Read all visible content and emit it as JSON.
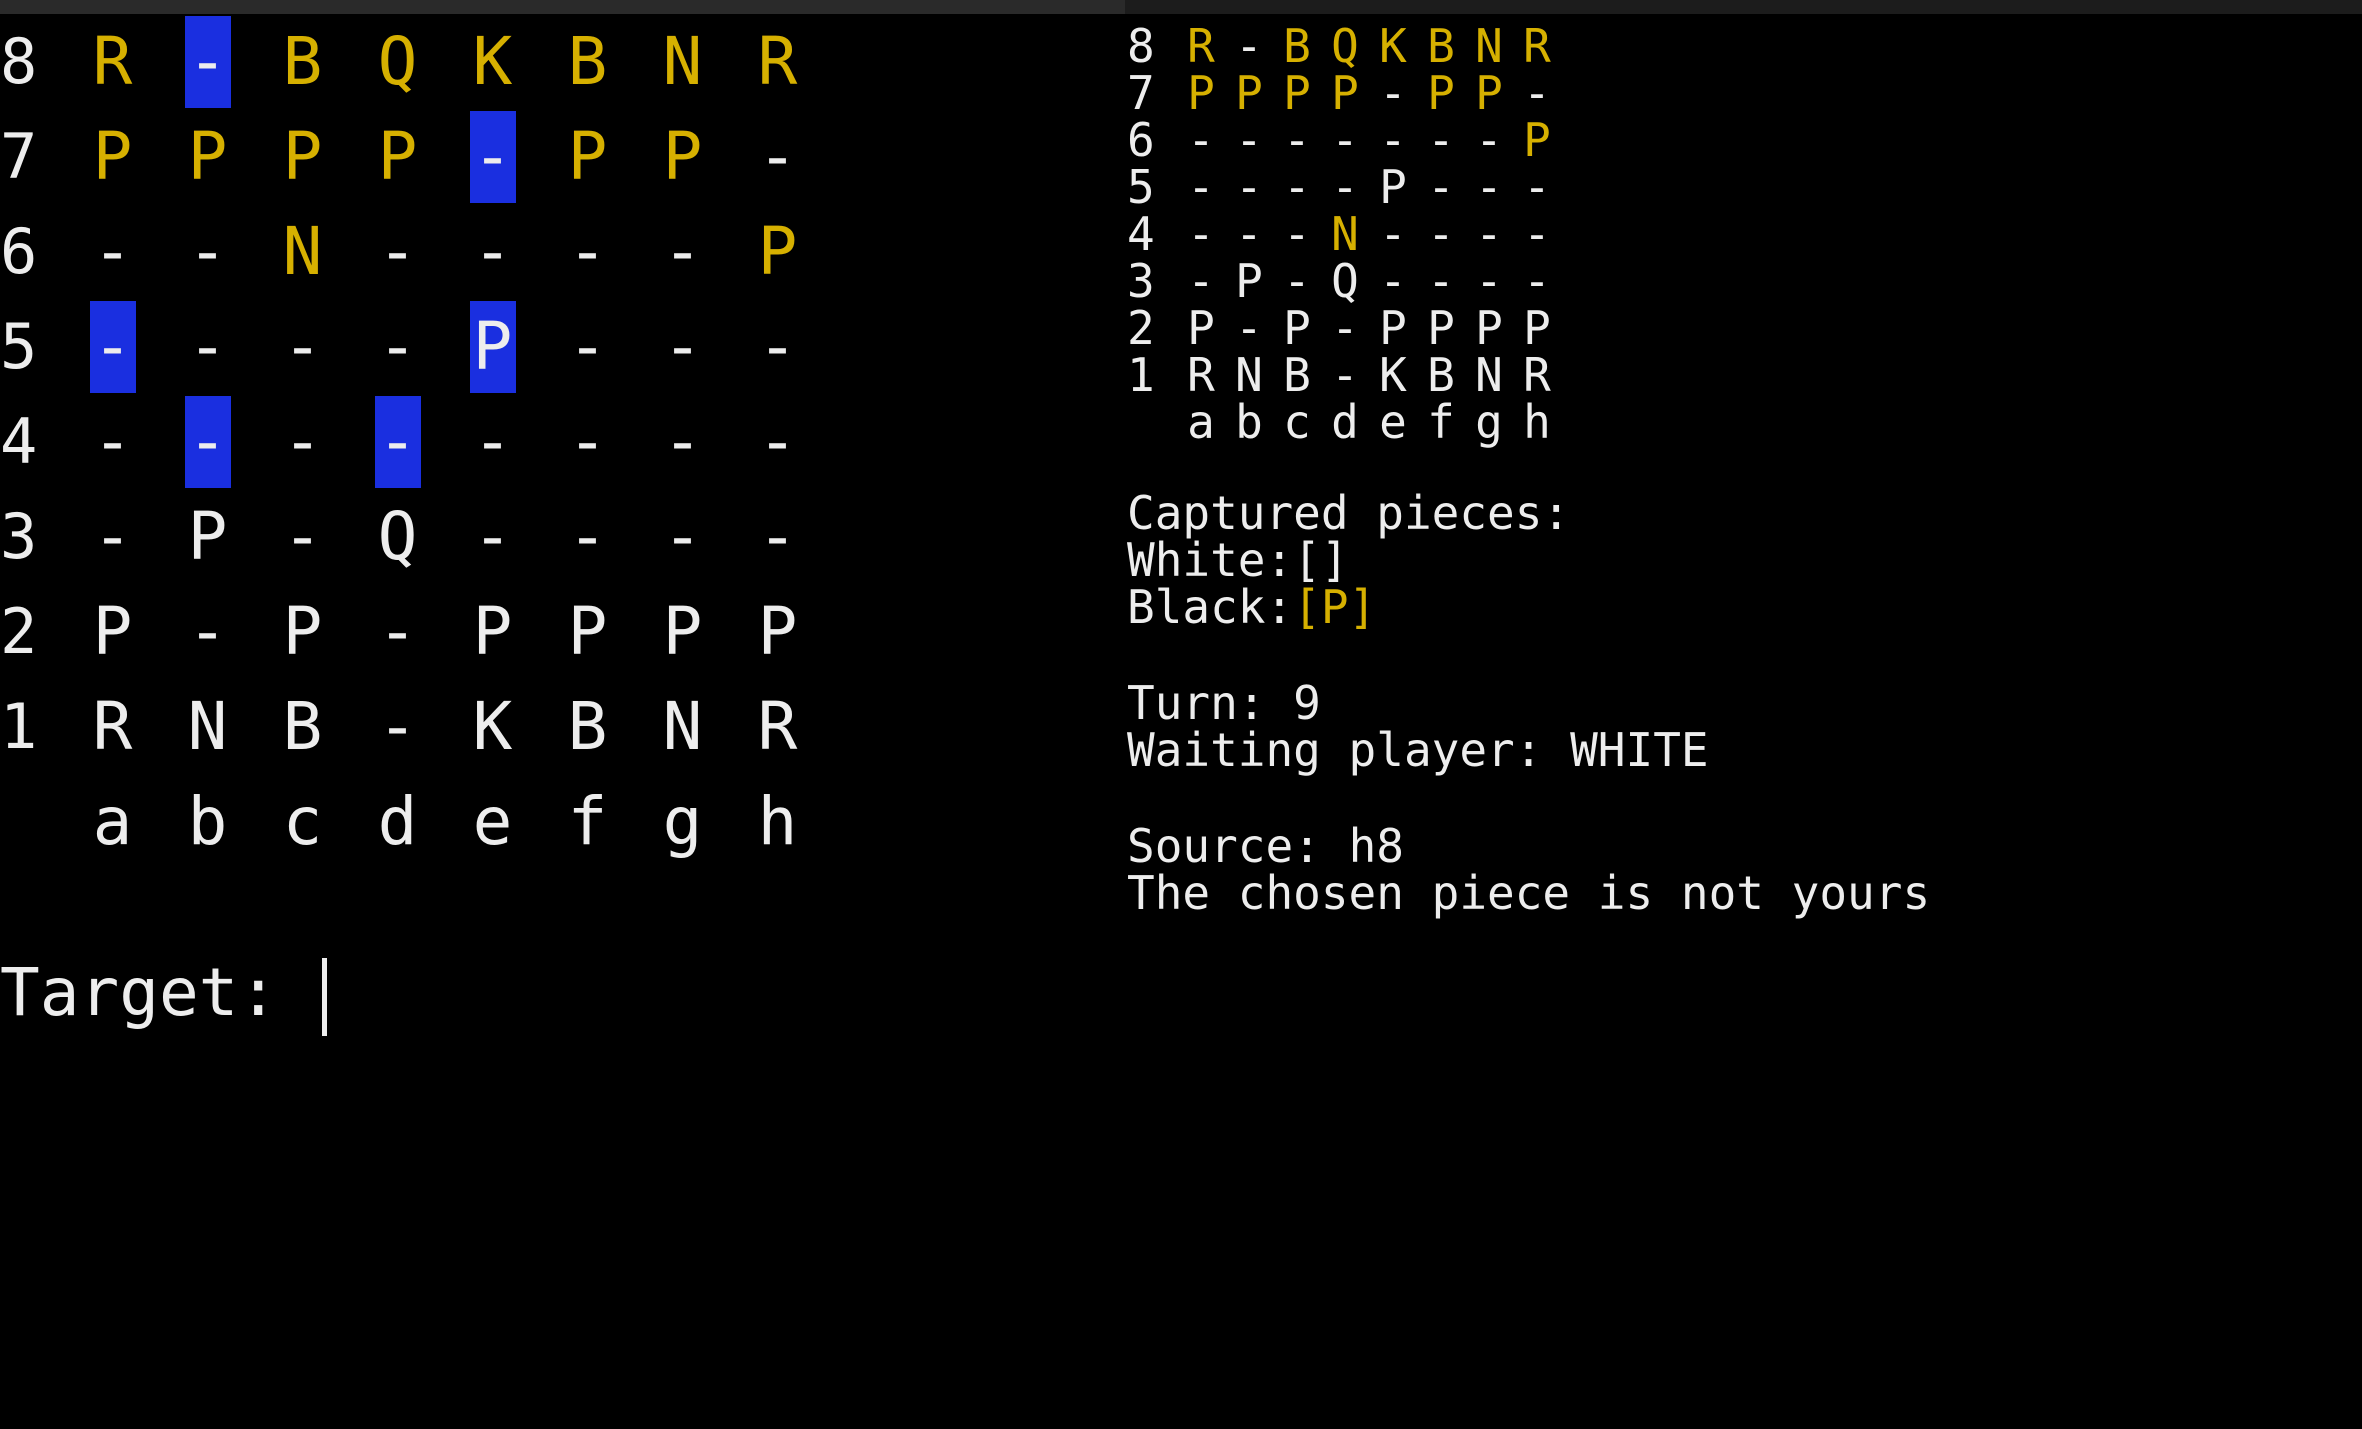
{
  "colors": {
    "background": "#000000",
    "white_text": "#ededed",
    "black_piece": "#d6b000",
    "highlight": "#1a2fe0"
  },
  "left_board": {
    "files": [
      "a",
      "b",
      "c",
      "d",
      "e",
      "f",
      "g",
      "h"
    ],
    "rows": [
      {
        "rank": "8",
        "cells": [
          {
            "c": "R",
            "side": "black"
          },
          {
            "c": "-",
            "side": "empty",
            "hl": true
          },
          {
            "c": "B",
            "side": "black"
          },
          {
            "c": "Q",
            "side": "black"
          },
          {
            "c": "K",
            "side": "black"
          },
          {
            "c": "B",
            "side": "black"
          },
          {
            "c": "N",
            "side": "black"
          },
          {
            "c": "R",
            "side": "black"
          }
        ]
      },
      {
        "rank": "7",
        "cells": [
          {
            "c": "P",
            "side": "black"
          },
          {
            "c": "P",
            "side": "black"
          },
          {
            "c": "P",
            "side": "black"
          },
          {
            "c": "P",
            "side": "black"
          },
          {
            "c": "-",
            "side": "empty",
            "hl": true
          },
          {
            "c": "P",
            "side": "black"
          },
          {
            "c": "P",
            "side": "black"
          },
          {
            "c": "-",
            "side": "empty"
          }
        ]
      },
      {
        "rank": "6",
        "cells": [
          {
            "c": "-",
            "side": "empty"
          },
          {
            "c": "-",
            "side": "empty"
          },
          {
            "c": "N",
            "side": "black"
          },
          {
            "c": "-",
            "side": "empty"
          },
          {
            "c": "-",
            "side": "empty"
          },
          {
            "c": "-",
            "side": "empty"
          },
          {
            "c": "-",
            "side": "empty"
          },
          {
            "c": "P",
            "side": "black"
          }
        ]
      },
      {
        "rank": "5",
        "cells": [
          {
            "c": "-",
            "side": "empty",
            "hl": true
          },
          {
            "c": "-",
            "side": "empty"
          },
          {
            "c": "-",
            "side": "empty"
          },
          {
            "c": "-",
            "side": "empty"
          },
          {
            "c": "P",
            "side": "white",
            "hl": true
          },
          {
            "c": "-",
            "side": "empty"
          },
          {
            "c": "-",
            "side": "empty"
          },
          {
            "c": "-",
            "side": "empty"
          }
        ]
      },
      {
        "rank": "4",
        "cells": [
          {
            "c": "-",
            "side": "empty"
          },
          {
            "c": "-",
            "side": "empty",
            "hl": true
          },
          {
            "c": "-",
            "side": "empty"
          },
          {
            "c": "-",
            "side": "empty",
            "hl": true
          },
          {
            "c": "-",
            "side": "empty"
          },
          {
            "c": "-",
            "side": "empty"
          },
          {
            "c": "-",
            "side": "empty"
          },
          {
            "c": "-",
            "side": "empty"
          }
        ]
      },
      {
        "rank": "3",
        "cells": [
          {
            "c": "-",
            "side": "empty"
          },
          {
            "c": "P",
            "side": "white"
          },
          {
            "c": "-",
            "side": "empty"
          },
          {
            "c": "Q",
            "side": "white"
          },
          {
            "c": "-",
            "side": "empty"
          },
          {
            "c": "-",
            "side": "empty"
          },
          {
            "c": "-",
            "side": "empty"
          },
          {
            "c": "-",
            "side": "empty"
          }
        ]
      },
      {
        "rank": "2",
        "cells": [
          {
            "c": "P",
            "side": "white"
          },
          {
            "c": "-",
            "side": "empty"
          },
          {
            "c": "P",
            "side": "white"
          },
          {
            "c": "-",
            "side": "empty"
          },
          {
            "c": "P",
            "side": "white"
          },
          {
            "c": "P",
            "side": "white"
          },
          {
            "c": "P",
            "side": "white"
          },
          {
            "c": "P",
            "side": "white"
          }
        ]
      },
      {
        "rank": "1",
        "cells": [
          {
            "c": "R",
            "side": "white"
          },
          {
            "c": "N",
            "side": "white"
          },
          {
            "c": "B",
            "side": "white"
          },
          {
            "c": "-",
            "side": "empty"
          },
          {
            "c": "K",
            "side": "white"
          },
          {
            "c": "B",
            "side": "white"
          },
          {
            "c": "N",
            "side": "white"
          },
          {
            "c": "R",
            "side": "white"
          }
        ]
      }
    ]
  },
  "prompt": {
    "label": "Target: ",
    "value": ""
  },
  "right_board": {
    "files": [
      "a",
      "b",
      "c",
      "d",
      "e",
      "f",
      "g",
      "h"
    ],
    "rows": [
      {
        "rank": "8",
        "cells": [
          {
            "c": "R",
            "side": "black"
          },
          {
            "c": "-",
            "side": "empty"
          },
          {
            "c": "B",
            "side": "black"
          },
          {
            "c": "Q",
            "side": "black"
          },
          {
            "c": "K",
            "side": "black"
          },
          {
            "c": "B",
            "side": "black"
          },
          {
            "c": "N",
            "side": "black"
          },
          {
            "c": "R",
            "side": "black"
          }
        ]
      },
      {
        "rank": "7",
        "cells": [
          {
            "c": "P",
            "side": "black"
          },
          {
            "c": "P",
            "side": "black"
          },
          {
            "c": "P",
            "side": "black"
          },
          {
            "c": "P",
            "side": "black"
          },
          {
            "c": "-",
            "side": "empty"
          },
          {
            "c": "P",
            "side": "black"
          },
          {
            "c": "P",
            "side": "black"
          },
          {
            "c": "-",
            "side": "empty"
          }
        ]
      },
      {
        "rank": "6",
        "cells": [
          {
            "c": "-",
            "side": "empty"
          },
          {
            "c": "-",
            "side": "empty"
          },
          {
            "c": "-",
            "side": "empty"
          },
          {
            "c": "-",
            "side": "empty"
          },
          {
            "c": "-",
            "side": "empty"
          },
          {
            "c": "-",
            "side": "empty"
          },
          {
            "c": "-",
            "side": "empty"
          },
          {
            "c": "P",
            "side": "black"
          }
        ]
      },
      {
        "rank": "5",
        "cells": [
          {
            "c": "-",
            "side": "empty"
          },
          {
            "c": "-",
            "side": "empty"
          },
          {
            "c": "-",
            "side": "empty"
          },
          {
            "c": "-",
            "side": "empty"
          },
          {
            "c": "P",
            "side": "white"
          },
          {
            "c": "-",
            "side": "empty"
          },
          {
            "c": "-",
            "side": "empty"
          },
          {
            "c": "-",
            "side": "empty"
          }
        ]
      },
      {
        "rank": "4",
        "cells": [
          {
            "c": "-",
            "side": "empty"
          },
          {
            "c": "-",
            "side": "empty"
          },
          {
            "c": "-",
            "side": "empty"
          },
          {
            "c": "N",
            "side": "black"
          },
          {
            "c": "-",
            "side": "empty"
          },
          {
            "c": "-",
            "side": "empty"
          },
          {
            "c": "-",
            "side": "empty"
          },
          {
            "c": "-",
            "side": "empty"
          }
        ]
      },
      {
        "rank": "3",
        "cells": [
          {
            "c": "-",
            "side": "empty"
          },
          {
            "c": "P",
            "side": "white"
          },
          {
            "c": "-",
            "side": "empty"
          },
          {
            "c": "Q",
            "side": "white"
          },
          {
            "c": "-",
            "side": "empty"
          },
          {
            "c": "-",
            "side": "empty"
          },
          {
            "c": "-",
            "side": "empty"
          },
          {
            "c": "-",
            "side": "empty"
          }
        ]
      },
      {
        "rank": "2",
        "cells": [
          {
            "c": "P",
            "side": "white"
          },
          {
            "c": "-",
            "side": "empty"
          },
          {
            "c": "P",
            "side": "white"
          },
          {
            "c": "-",
            "side": "empty"
          },
          {
            "c": "P",
            "side": "white"
          },
          {
            "c": "P",
            "side": "white"
          },
          {
            "c": "P",
            "side": "white"
          },
          {
            "c": "P",
            "side": "white"
          }
        ]
      },
      {
        "rank": "1",
        "cells": [
          {
            "c": "R",
            "side": "white"
          },
          {
            "c": "N",
            "side": "white"
          },
          {
            "c": "B",
            "side": "white"
          },
          {
            "c": "-",
            "side": "empty"
          },
          {
            "c": "K",
            "side": "white"
          },
          {
            "c": "B",
            "side": "white"
          },
          {
            "c": "N",
            "side": "white"
          },
          {
            "c": "R",
            "side": "white"
          }
        ]
      }
    ]
  },
  "info": {
    "captured_title": "Captured pieces:",
    "white_label": "White:",
    "white_captured": "[]",
    "black_label": "Black:",
    "black_captured": "[P]",
    "turn_label": "Turn: ",
    "turn_value": "9",
    "waiting_label": "Waiting player: ",
    "waiting_value": "WHITE",
    "source_label": "Source: ",
    "source_value": "h8",
    "message": "The chosen piece is not yours"
  }
}
